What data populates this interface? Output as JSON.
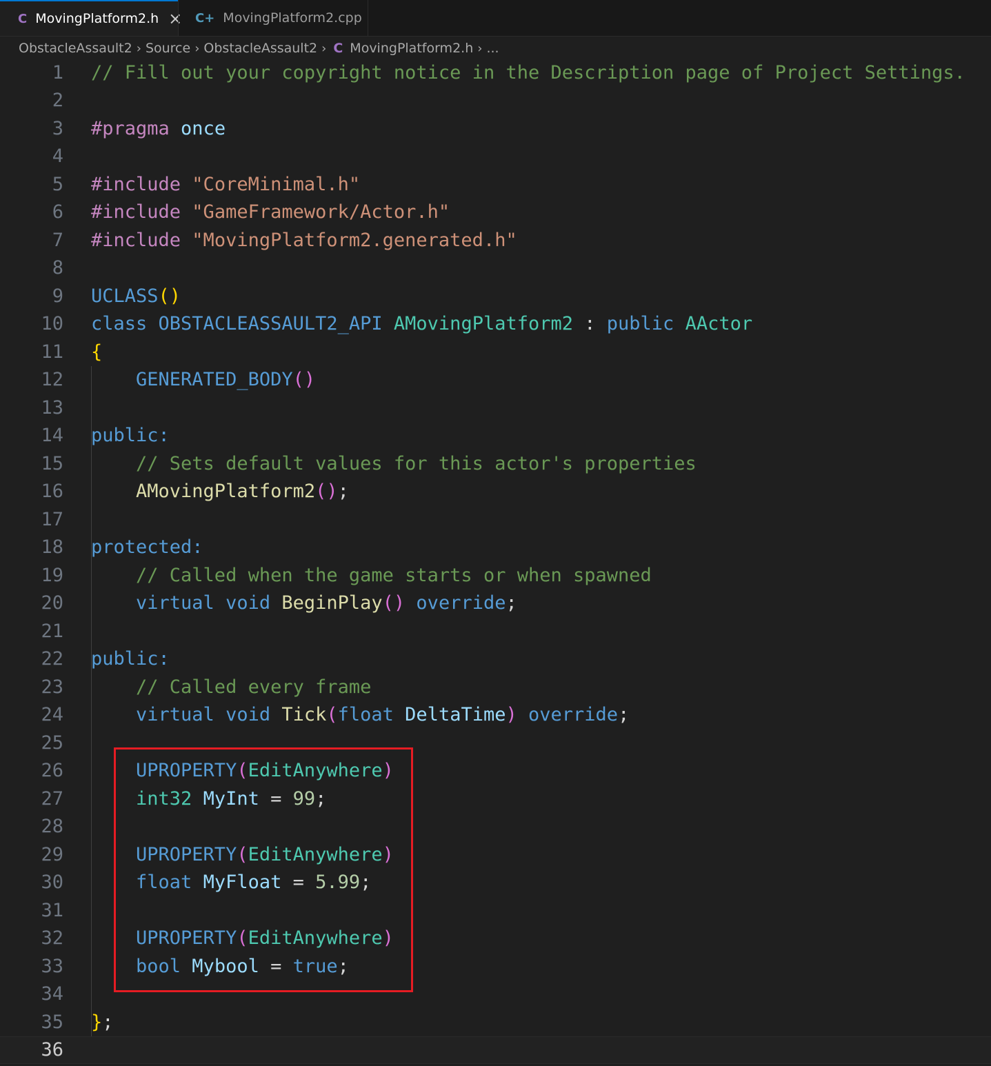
{
  "tabs": [
    {
      "icon": "C",
      "label": "MovingPlatform2.h",
      "active": true
    },
    {
      "icon": "C+",
      "label": "MovingPlatform2.cpp",
      "active": false
    }
  ],
  "breadcrumb": {
    "items": [
      "ObstacleAssault2",
      "Source",
      "ObstacleAssault2",
      "MovingPlatform2.h",
      "..."
    ]
  },
  "editor": {
    "current_line": 36,
    "line_numbers": [
      "1",
      "2",
      "3",
      "4",
      "5",
      "6",
      "7",
      "8",
      "9",
      "10",
      "11",
      "12",
      "13",
      "14",
      "15",
      "16",
      "17",
      "18",
      "19",
      "20",
      "21",
      "22",
      "23",
      "24",
      "25",
      "26",
      "27",
      "28",
      "29",
      "30",
      "31",
      "32",
      "33",
      "34",
      "35",
      "36"
    ],
    "code": {
      "l1": "// Fill out your copyright notice in the Description page of Project Settings.",
      "l3_a": "#pragma",
      "l3_b": " once",
      "l5_a": "#include",
      "l5_b": " \"CoreMinimal.h\"",
      "l6_a": "#include",
      "l6_b": " \"GameFramework/Actor.h\"",
      "l7_a": "#include",
      "l7_b": " \"MovingPlatform2.generated.h\"",
      "l9_a": "UCLASS",
      "l9_b": "()",
      "l10_a": "class",
      "l10_b": " OBSTACLEASSAULT2_API ",
      "l10_c": "AMovingPlatform2",
      "l10_d": " : ",
      "l10_e": "public",
      "l10_f": " AActor",
      "l11": "{",
      "l12_a": "    GENERATED_BODY",
      "l12_b": "()",
      "l14": "public:",
      "l15": "    // Sets default values for this actor's properties",
      "l16_a": "    AMovingPlatform2",
      "l16_b": "()",
      "l16_c": ";",
      "l18": "protected:",
      "l19": "    // Called when the game starts or when spawned",
      "l20_a": "    virtual",
      "l20_b": " void",
      "l20_c": " BeginPlay",
      "l20_d": "()",
      "l20_e": " override",
      "l20_f": ";",
      "l22": "public:",
      "l23": "    // Called every frame",
      "l24_a": "    virtual",
      "l24_b": " void",
      "l24_c": " Tick",
      "l24_d": "(",
      "l24_e": "float",
      "l24_f": " DeltaTime",
      "l24_g": ")",
      "l24_h": " override",
      "l24_i": ";",
      "l26_a": "    UPROPERTY",
      "l26_b": "(",
      "l26_c": "EditAnywhere",
      "l26_d": ")",
      "l27_a": "    int32",
      "l27_b": " MyInt",
      "l27_c": " = ",
      "l27_d": "99",
      "l27_e": ";",
      "l29_a": "    UPROPERTY",
      "l29_b": "(",
      "l29_c": "EditAnywhere",
      "l29_d": ")",
      "l30_a": "    float",
      "l30_b": " MyFloat",
      "l30_c": " = ",
      "l30_d": "5.99",
      "l30_e": ";",
      "l32_a": "    UPROPERTY",
      "l32_b": "(",
      "l32_c": "EditAnywhere",
      "l32_d": ")",
      "l33_a": "    bool",
      "l33_b": " Mybool",
      "l33_c": " = ",
      "l33_d": "true",
      "l33_e": ";",
      "l35_a": "}",
      "l35_b": ";"
    }
  },
  "colors": {
    "highlight_border": "#e51c23",
    "comment": "#6a9955",
    "keyword": "#569cd6",
    "string": "#ce9178",
    "type": "#4ec9b0"
  }
}
